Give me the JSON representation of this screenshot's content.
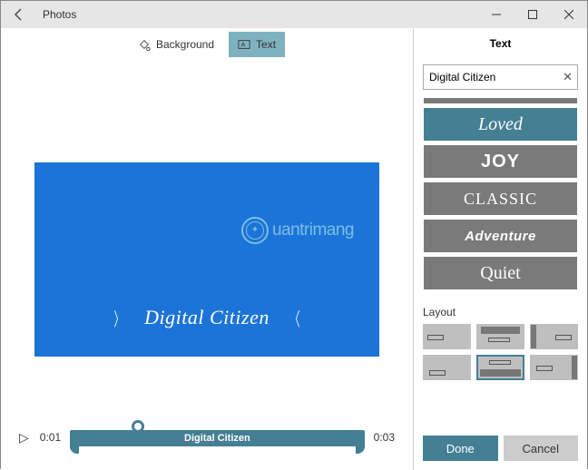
{
  "titlebar": {
    "app_name": "Photos"
  },
  "toolbar": {
    "background_label": "Background",
    "text_label": "Text"
  },
  "preview": {
    "text": "Digital Citizen",
    "watermark": "uantrimang"
  },
  "timeline": {
    "start": "0:01",
    "end": "0:03",
    "clip_label": "Digital Citizen"
  },
  "panel": {
    "title": "Text",
    "input_value": "Digital Citizen",
    "styles": [
      {
        "key": "loved",
        "label": "Loved",
        "selected": true
      },
      {
        "key": "joy",
        "label": "JOY",
        "selected": false
      },
      {
        "key": "classic",
        "label": "CLASSIC",
        "selected": false
      },
      {
        "key": "adventure",
        "label": "Adventure",
        "selected": false
      },
      {
        "key": "quiet",
        "label": "Quiet",
        "selected": false
      }
    ],
    "layout_label": "Layout",
    "done_label": "Done",
    "cancel_label": "Cancel"
  }
}
